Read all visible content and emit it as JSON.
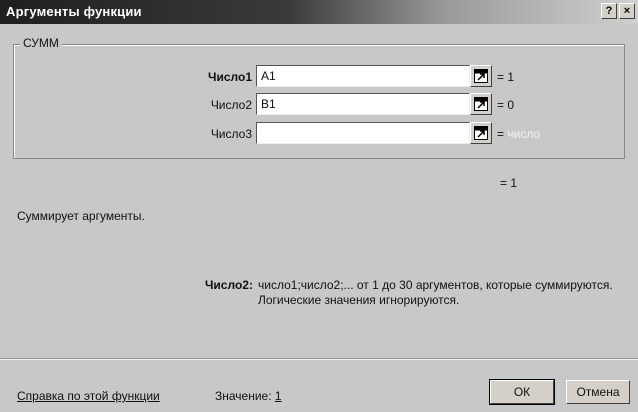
{
  "window": {
    "title": "Аргументы функции",
    "help_glyph": "?",
    "close_glyph": "×"
  },
  "function": {
    "name": "СУММ",
    "arguments": [
      {
        "label": "Число1",
        "value": "A1",
        "result": "= 1",
        "bold": true
      },
      {
        "label": "Число2",
        "value": "B1",
        "result": "= 0",
        "bold": false
      },
      {
        "label": "Число3",
        "value": "",
        "result_prefix": "=",
        "result_placeholder": "число",
        "bold": false
      }
    ],
    "result": "= 1",
    "description": "Суммирует аргументы.",
    "current_arg_name": "Число2:",
    "current_arg_help": "число1;число2;... от 1 до 30 аргументов, которые суммируются. Логические значения игнорируются."
  },
  "footer": {
    "help_link": "Справка по этой функции",
    "value_label": "Значение:",
    "value": "1",
    "ok_label": "ОК",
    "cancel_label": "Отмена"
  },
  "icons": {
    "collapse_dialog": "collapse-dialog-icon"
  }
}
